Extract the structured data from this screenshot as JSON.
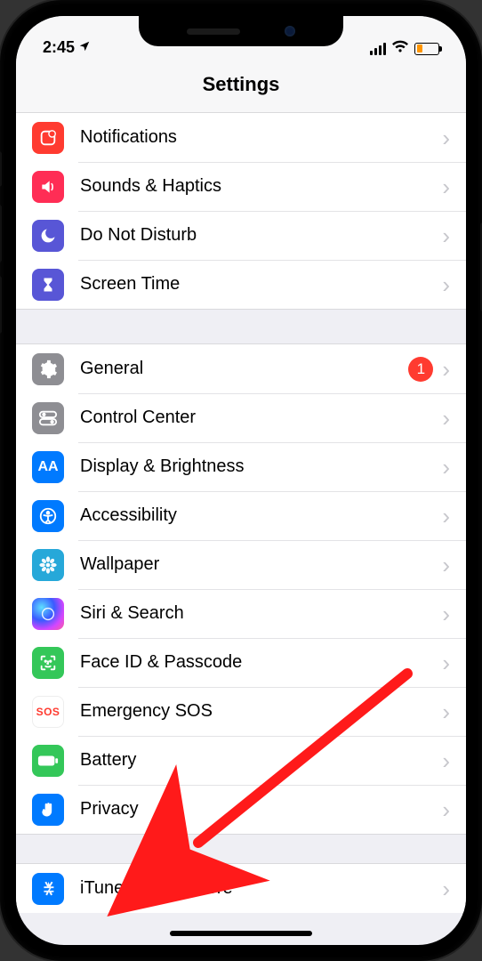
{
  "status": {
    "time": "2:45"
  },
  "title": "Settings",
  "sections": [
    {
      "rows": [
        {
          "id": "notifications",
          "label": "Notifications",
          "icon": "notification-icon",
          "bg": "bg-red"
        },
        {
          "id": "sounds",
          "label": "Sounds & Haptics",
          "icon": "speaker-icon",
          "bg": "bg-pink"
        },
        {
          "id": "dnd",
          "label": "Do Not Disturb",
          "icon": "moon-icon",
          "bg": "bg-purple"
        },
        {
          "id": "screentime",
          "label": "Screen Time",
          "icon": "hourglass-icon",
          "bg": "bg-purple"
        }
      ]
    },
    {
      "rows": [
        {
          "id": "general",
          "label": "General",
          "icon": "gear-icon",
          "bg": "bg-gray",
          "badge": "1"
        },
        {
          "id": "controlcenter",
          "label": "Control Center",
          "icon": "toggles-icon",
          "bg": "bg-gray"
        },
        {
          "id": "display",
          "label": "Display & Brightness",
          "icon": "aa-icon",
          "bg": "bg-blue",
          "icon_text": "AA"
        },
        {
          "id": "accessibility",
          "label": "Accessibility",
          "icon": "person-circle-icon",
          "bg": "bg-blue"
        },
        {
          "id": "wallpaper",
          "label": "Wallpaper",
          "icon": "flower-icon",
          "bg": "bg-teal"
        },
        {
          "id": "siri",
          "label": "Siri & Search",
          "icon": "siri-icon",
          "bg": "bg-siri"
        },
        {
          "id": "faceid",
          "label": "Face ID & Passcode",
          "icon": "face-id-icon",
          "bg": "bg-green"
        },
        {
          "id": "sos",
          "label": "Emergency SOS",
          "icon": "sos-icon",
          "bg": "bg-sos",
          "icon_text": "SOS"
        },
        {
          "id": "battery",
          "label": "Battery",
          "icon": "battery-icon",
          "bg": "bg-green"
        },
        {
          "id": "privacy",
          "label": "Privacy",
          "icon": "hand-icon",
          "bg": "bg-blue"
        }
      ]
    },
    {
      "rows": [
        {
          "id": "itunes",
          "label": "iTunes & App Store",
          "icon": "appstore-icon",
          "bg": "bg-blue"
        }
      ]
    }
  ],
  "annotation": {
    "points_to": "privacy"
  }
}
